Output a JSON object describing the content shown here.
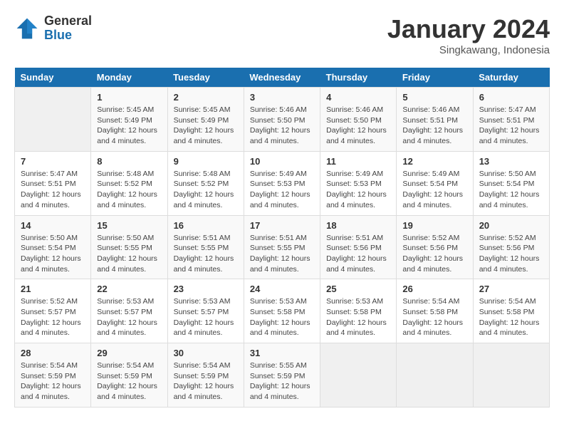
{
  "header": {
    "logo_general": "General",
    "logo_blue": "Blue",
    "month_title": "January 2024",
    "subtitle": "Singkawang, Indonesia"
  },
  "weekdays": [
    "Sunday",
    "Monday",
    "Tuesday",
    "Wednesday",
    "Thursday",
    "Friday",
    "Saturday"
  ],
  "weeks": [
    [
      {
        "day": "",
        "info": ""
      },
      {
        "day": "1",
        "info": "Sunrise: 5:45 AM\nSunset: 5:49 PM\nDaylight: 12 hours\nand 4 minutes."
      },
      {
        "day": "2",
        "info": "Sunrise: 5:45 AM\nSunset: 5:49 PM\nDaylight: 12 hours\nand 4 minutes."
      },
      {
        "day": "3",
        "info": "Sunrise: 5:46 AM\nSunset: 5:50 PM\nDaylight: 12 hours\nand 4 minutes."
      },
      {
        "day": "4",
        "info": "Sunrise: 5:46 AM\nSunset: 5:50 PM\nDaylight: 12 hours\nand 4 minutes."
      },
      {
        "day": "5",
        "info": "Sunrise: 5:46 AM\nSunset: 5:51 PM\nDaylight: 12 hours\nand 4 minutes."
      },
      {
        "day": "6",
        "info": "Sunrise: 5:47 AM\nSunset: 5:51 PM\nDaylight: 12 hours\nand 4 minutes."
      }
    ],
    [
      {
        "day": "7",
        "info": "Sunrise: 5:47 AM\nSunset: 5:51 PM\nDaylight: 12 hours\nand 4 minutes."
      },
      {
        "day": "8",
        "info": "Sunrise: 5:48 AM\nSunset: 5:52 PM\nDaylight: 12 hours\nand 4 minutes."
      },
      {
        "day": "9",
        "info": "Sunrise: 5:48 AM\nSunset: 5:52 PM\nDaylight: 12 hours\nand 4 minutes."
      },
      {
        "day": "10",
        "info": "Sunrise: 5:49 AM\nSunset: 5:53 PM\nDaylight: 12 hours\nand 4 minutes."
      },
      {
        "day": "11",
        "info": "Sunrise: 5:49 AM\nSunset: 5:53 PM\nDaylight: 12 hours\nand 4 minutes."
      },
      {
        "day": "12",
        "info": "Sunrise: 5:49 AM\nSunset: 5:54 PM\nDaylight: 12 hours\nand 4 minutes."
      },
      {
        "day": "13",
        "info": "Sunrise: 5:50 AM\nSunset: 5:54 PM\nDaylight: 12 hours\nand 4 minutes."
      }
    ],
    [
      {
        "day": "14",
        "info": "Sunrise: 5:50 AM\nSunset: 5:54 PM\nDaylight: 12 hours\nand 4 minutes."
      },
      {
        "day": "15",
        "info": "Sunrise: 5:50 AM\nSunset: 5:55 PM\nDaylight: 12 hours\nand 4 minutes."
      },
      {
        "day": "16",
        "info": "Sunrise: 5:51 AM\nSunset: 5:55 PM\nDaylight: 12 hours\nand 4 minutes."
      },
      {
        "day": "17",
        "info": "Sunrise: 5:51 AM\nSunset: 5:55 PM\nDaylight: 12 hours\nand 4 minutes."
      },
      {
        "day": "18",
        "info": "Sunrise: 5:51 AM\nSunset: 5:56 PM\nDaylight: 12 hours\nand 4 minutes."
      },
      {
        "day": "19",
        "info": "Sunrise: 5:52 AM\nSunset: 5:56 PM\nDaylight: 12 hours\nand 4 minutes."
      },
      {
        "day": "20",
        "info": "Sunrise: 5:52 AM\nSunset: 5:56 PM\nDaylight: 12 hours\nand 4 minutes."
      }
    ],
    [
      {
        "day": "21",
        "info": "Sunrise: 5:52 AM\nSunset: 5:57 PM\nDaylight: 12 hours\nand 4 minutes."
      },
      {
        "day": "22",
        "info": "Sunrise: 5:53 AM\nSunset: 5:57 PM\nDaylight: 12 hours\nand 4 minutes."
      },
      {
        "day": "23",
        "info": "Sunrise: 5:53 AM\nSunset: 5:57 PM\nDaylight: 12 hours\nand 4 minutes."
      },
      {
        "day": "24",
        "info": "Sunrise: 5:53 AM\nSunset: 5:58 PM\nDaylight: 12 hours\nand 4 minutes."
      },
      {
        "day": "25",
        "info": "Sunrise: 5:53 AM\nSunset: 5:58 PM\nDaylight: 12 hours\nand 4 minutes."
      },
      {
        "day": "26",
        "info": "Sunrise: 5:54 AM\nSunset: 5:58 PM\nDaylight: 12 hours\nand 4 minutes."
      },
      {
        "day": "27",
        "info": "Sunrise: 5:54 AM\nSunset: 5:58 PM\nDaylight: 12 hours\nand 4 minutes."
      }
    ],
    [
      {
        "day": "28",
        "info": "Sunrise: 5:54 AM\nSunset: 5:59 PM\nDaylight: 12 hours\nand 4 minutes."
      },
      {
        "day": "29",
        "info": "Sunrise: 5:54 AM\nSunset: 5:59 PM\nDaylight: 12 hours\nand 4 minutes."
      },
      {
        "day": "30",
        "info": "Sunrise: 5:54 AM\nSunset: 5:59 PM\nDaylight: 12 hours\nand 4 minutes."
      },
      {
        "day": "31",
        "info": "Sunrise: 5:55 AM\nSunset: 5:59 PM\nDaylight: 12 hours\nand 4 minutes."
      },
      {
        "day": "",
        "info": ""
      },
      {
        "day": "",
        "info": ""
      },
      {
        "day": "",
        "info": ""
      }
    ]
  ]
}
